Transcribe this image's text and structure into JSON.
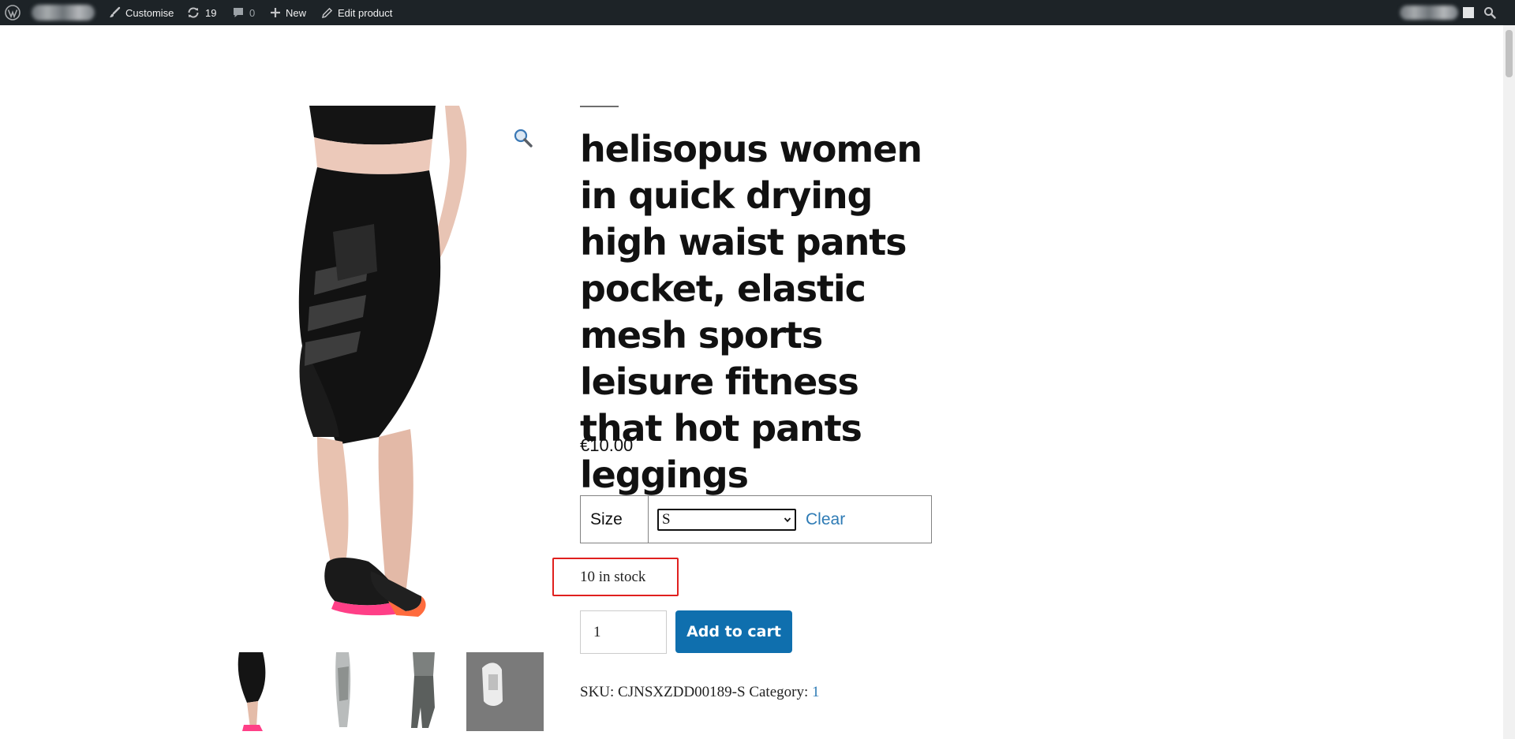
{
  "admin_bar": {
    "customise_label": "Customise",
    "updates_count": "19",
    "comments_count": "0",
    "new_label": "New",
    "edit_label": "Edit product"
  },
  "product": {
    "title": "helisopus women in quick drying high waist pants pocket, elastic mesh sports leisure fitness that hot pants leggings",
    "price": "€10.00",
    "variation": {
      "label": "Size",
      "selected": "S",
      "clear_label": "Clear"
    },
    "stock": "10 in stock",
    "quantity": "1",
    "add_to_cart_label": "Add to cart",
    "sku_label": "SKU:",
    "sku": "CJNSXZDD00189-S",
    "category_label": "Category:",
    "category": "1"
  },
  "colors": {
    "admin_bar_bg": "#1d2327",
    "button_blue": "#0f6fae",
    "link_blue": "#2e7bb5",
    "highlight_red": "#e0201e"
  },
  "icons": [
    "wordpress-logo-icon",
    "brush-icon",
    "updates-icon",
    "comment-icon",
    "plus-icon",
    "pencil-icon",
    "search-icon",
    "zoom-icon",
    "chevron-down-icon"
  ]
}
